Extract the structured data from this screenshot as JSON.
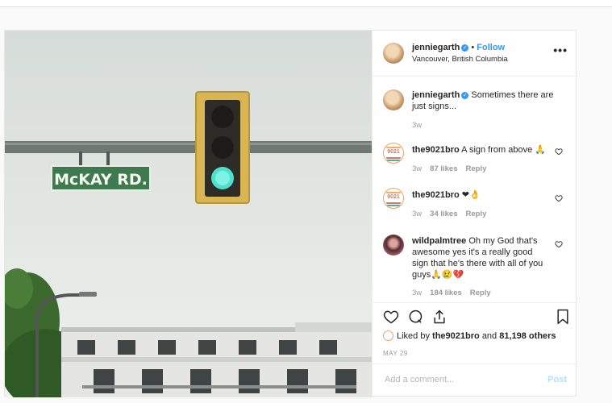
{
  "post": {
    "author": "jenniegarth",
    "follow_label": "Follow",
    "separator": "•",
    "location": "Vancouver, British Columbia",
    "more_label": "•••",
    "image": {
      "sign_text": "McKAY RD."
    }
  },
  "comments": [
    {
      "user": "jenniegarth",
      "text": "Sometimes there are just signs...",
      "time": "3w",
      "verified": true,
      "verified_mark": "✓"
    },
    {
      "user": "the9021bro",
      "text": "A sign from above 🙏",
      "time": "3w",
      "likes": "87 likes",
      "reply": "Reply"
    },
    {
      "user": "the9021bro",
      "text": "❤👌",
      "time": "3w",
      "likes": "34 likes",
      "reply": "Reply"
    },
    {
      "user": "wildpalmtree",
      "text": "Oh my God that's awesome yes it's a really good sign that he's there with all of you guys🙏😢💔",
      "time": "3w",
      "likes": "184 likes",
      "reply": "Reply"
    }
  ],
  "avatar_text": "9021",
  "likes_line": {
    "prefix": "Liked by",
    "user": "the9021bro",
    "and": "and",
    "count": "81,198 others"
  },
  "date": "MAY 29",
  "add_comment": {
    "placeholder": "Add a comment...",
    "post_label": "Post"
  },
  "colors": {
    "accent": "#3897f0",
    "muted": "#999999",
    "post_disabled": "#b2dffc"
  }
}
